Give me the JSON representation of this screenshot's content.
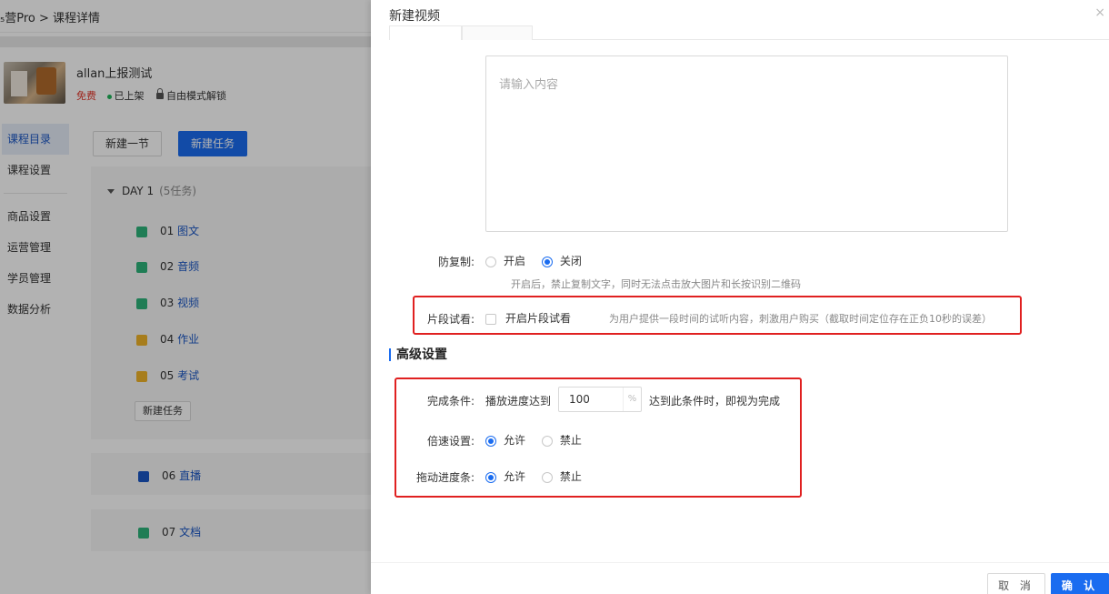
{
  "breadcrumb": "₅营Pro > 课程详情",
  "course": {
    "title": "allan上报测试",
    "price_tag": "免费",
    "status": "已上架",
    "unlock_mode": "自由模式解锁"
  },
  "sidenav": {
    "items": [
      "课程目录",
      "课程设置",
      "商品设置",
      "运营管理",
      "学员管理",
      "数据分析"
    ]
  },
  "toolbar": {
    "new_section": "新建一节",
    "new_task": "新建任务"
  },
  "outline": {
    "day_title": "DAY 1",
    "day_count": "(5任务)",
    "tasks": [
      {
        "num": "01",
        "type": "图文",
        "icon": "image-text-icon",
        "color": "#2db37a"
      },
      {
        "num": "02",
        "type": "音频",
        "icon": "audio-icon",
        "color": "#2db37a"
      },
      {
        "num": "03",
        "type": "视频",
        "icon": "video-icon",
        "color": "#2db37a"
      },
      {
        "num": "04",
        "type": "作业",
        "icon": "homework-icon",
        "color": "#f0b429"
      },
      {
        "num": "05",
        "type": "考试",
        "icon": "exam-icon",
        "color": "#f0b429"
      }
    ],
    "new_task_button": "新建任务",
    "extra_tasks": [
      {
        "num": "06",
        "type": "直播",
        "icon": "live-icon",
        "color": "#1a56c4"
      },
      {
        "num": "07",
        "type": "文档",
        "icon": "document-icon",
        "color": "#2db37a"
      }
    ]
  },
  "drawer": {
    "title": "新建视频",
    "close": "×",
    "textarea_placeholder": "请输入内容",
    "anti_copy": {
      "label": "防复制:",
      "options": [
        "开启",
        "关闭"
      ],
      "selected": "关闭",
      "hint": "开启后，禁止复制文字，同时无法点击放大图片和长按识别二维码"
    },
    "trial": {
      "label": "片段试看:",
      "checkbox_label": "开启片段试看",
      "hint": "为用户提供一段时间的试听内容，刺激用户购买（截取时间定位存在正负10秒的误差）"
    },
    "advanced_title": "高级设置",
    "completion": {
      "label": "完成条件:",
      "prefix": "播放进度达到",
      "value": "100",
      "suffix_unit": "%",
      "suffix_text": "达到此条件时，即视为完成"
    },
    "speed": {
      "label": "倍速设置:",
      "options": [
        "允许",
        "禁止"
      ],
      "selected": "允许"
    },
    "drag": {
      "label": "拖动进度条:",
      "options": [
        "允许",
        "禁止"
      ],
      "selected": "允许"
    },
    "footer": {
      "cancel": "取 消",
      "confirm": "确 认"
    }
  },
  "colors": {
    "primary": "#1a6cf0",
    "highlight_box": "#e02020"
  }
}
